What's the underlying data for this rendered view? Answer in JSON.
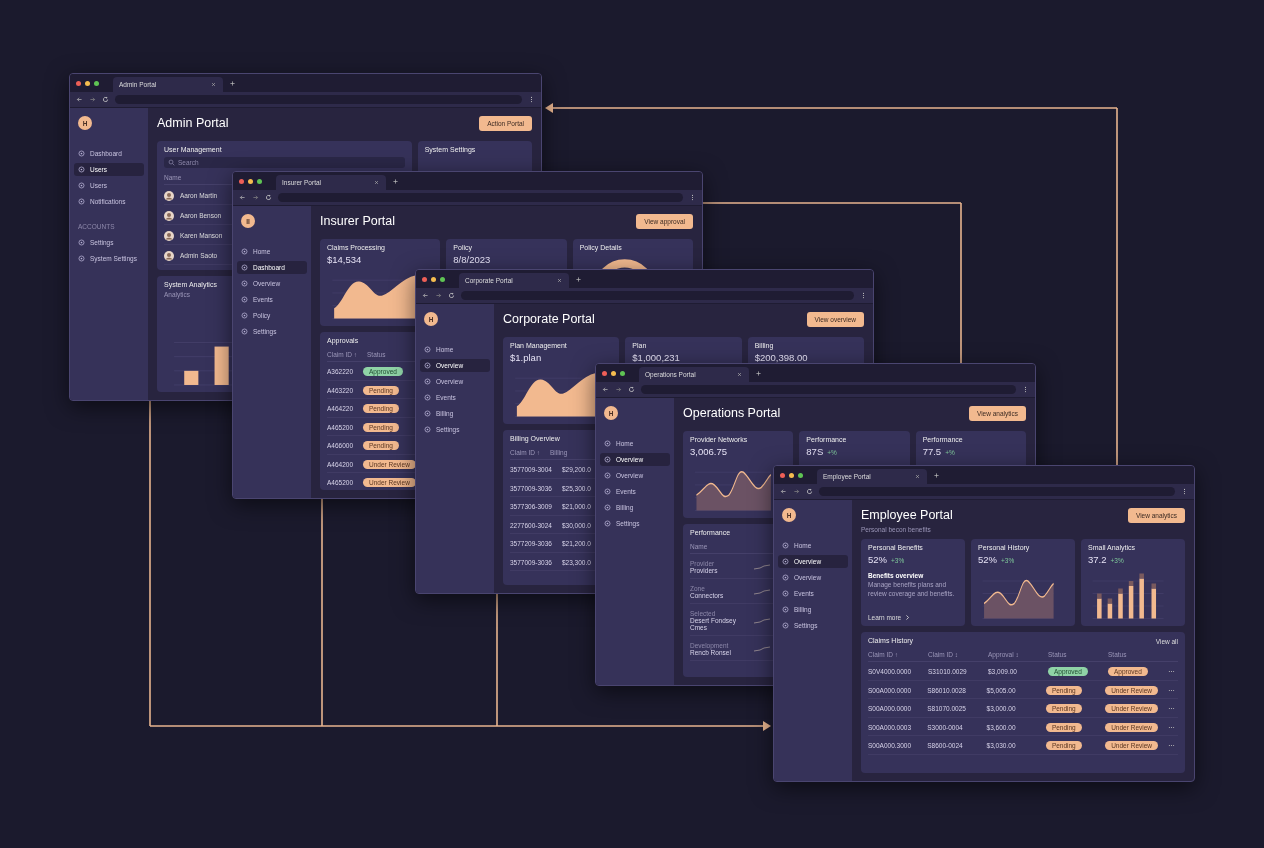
{
  "windows": [
    {
      "tab": "Admin Portal",
      "logo": "H",
      "heading": "Admin Portal",
      "action": "Action Portal",
      "nav": [
        {
          "label": "Dashboard",
          "selected": false
        },
        {
          "label": "Users",
          "selected": true
        },
        {
          "label": "Users",
          "selected": false
        },
        {
          "label": "Notifications",
          "selected": false
        }
      ],
      "nav_section": {
        "label": "ACCOUNTS",
        "items": [
          {
            "label": "Settings",
            "selected": false
          },
          {
            "label": "System Settings",
            "selected": false
          }
        ]
      },
      "rows": [
        [
          {
            "kind": "users",
            "title": "User Management",
            "placeholder": "Search",
            "columns": [
              "Name"
            ],
            "rows": [
              {
                "name": "Aaron Martin"
              },
              {
                "name": "Aaron Benson"
              },
              {
                "name": "Karen Manson"
              },
              {
                "name": "Admin Saoto"
              }
            ]
          },
          {
            "kind": "settings",
            "title": "System Settings"
          }
        ],
        [
          {
            "kind": "analytics",
            "title": "System Analytics",
            "subtitle": "Analytics"
          }
        ]
      ]
    },
    {
      "tab": "Insurer Portal",
      "logo": "II",
      "heading": "Insurer Portal",
      "action": "View approval",
      "nav": [
        {
          "label": "Home",
          "selected": false
        },
        {
          "label": "Dashboard",
          "selected": true
        },
        {
          "label": "Overview",
          "selected": false
        },
        {
          "label": "Events",
          "selected": false
        },
        {
          "label": "Policy",
          "selected": false
        },
        {
          "label": "Settings",
          "selected": false
        }
      ],
      "rows": [
        [
          {
            "kind": "area_stat",
            "title": "Claims Processing",
            "value": "$14,534"
          },
          {
            "kind": "stat",
            "title": "Policy",
            "value": "8/8/2023"
          },
          {
            "kind": "donut_stat",
            "title": "Policy Details"
          }
        ],
        [
          {
            "kind": "table",
            "title": "Approvals",
            "columns": [
              "Claim ID ↑",
              "Status"
            ],
            "rows": [
              {
                "cells": [
                  "A362220"
                ],
                "statuses": [
                  {
                    "label": "Approved",
                    "kind": "approved"
                  }
                ]
              },
              {
                "cells": [
                  "A463220"
                ],
                "statuses": [
                  {
                    "label": "Pending",
                    "kind": "pending"
                  }
                ]
              },
              {
                "cells": [
                  "A464220"
                ],
                "statuses": [
                  {
                    "label": "Pending",
                    "kind": "pending"
                  }
                ]
              },
              {
                "cells": [
                  "A465200"
                ],
                "statuses": [
                  {
                    "label": "Pending",
                    "kind": "pending"
                  }
                ]
              },
              {
                "cells": [
                  "A466000"
                ],
                "statuses": [
                  {
                    "label": "Pending",
                    "kind": "pending"
                  }
                ]
              },
              {
                "cells": [
                  "A464200"
                ],
                "statuses": [
                  {
                    "label": "Under Review",
                    "kind": "pending"
                  }
                ]
              },
              {
                "cells": [
                  "A465200"
                ],
                "statuses": [
                  {
                    "label": "Under Review",
                    "kind": "pending"
                  }
                ]
              }
            ]
          }
        ]
      ]
    },
    {
      "tab": "Corporate Portal",
      "logo": "H",
      "heading": "Corporate Portal",
      "action": "View overview",
      "nav": [
        {
          "label": "Home",
          "selected": false
        },
        {
          "label": "Overview",
          "selected": true
        },
        {
          "label": "Overview",
          "selected": false
        },
        {
          "label": "Events",
          "selected": false
        },
        {
          "label": "Billing",
          "selected": false
        },
        {
          "label": "Settings",
          "selected": false
        }
      ],
      "rows": [
        [
          {
            "kind": "area_stat",
            "title": "Plan Management",
            "value": "$1.plan"
          },
          {
            "kind": "stat",
            "title": "Plan",
            "value": "$1,000,231"
          },
          {
            "kind": "stat",
            "title": "Billing",
            "value": "$200,398.00"
          }
        ],
        [
          {
            "kind": "table",
            "title": "Billing Overview",
            "columns": [
              "Claim ID ↑",
              "Billing"
            ],
            "rows": [
              {
                "cells": [
                  "3577009-3004",
                  "$29,200.0"
                ]
              },
              {
                "cells": [
                  "3577009-3036",
                  "$25,300.0"
                ]
              },
              {
                "cells": [
                  "3577306-3009",
                  "$21,000.0"
                ]
              },
              {
                "cells": [
                  "2277600-3024",
                  "$30,000.0"
                ]
              },
              {
                "cells": [
                  "3577209-3036",
                  "$21,200.0"
                ]
              },
              {
                "cells": [
                  "3577009-3036",
                  "$23,300.0"
                ]
              }
            ]
          }
        ]
      ]
    },
    {
      "tab": "Operations Portal",
      "logo": "H",
      "heading": "Operations Portal",
      "action": "View analytics",
      "nav": [
        {
          "label": "Home",
          "selected": false
        },
        {
          "label": "Overview",
          "selected": true
        },
        {
          "label": "Overview",
          "selected": false
        },
        {
          "label": "Events",
          "selected": false
        },
        {
          "label": "Billing",
          "selected": false
        },
        {
          "label": "Settings",
          "selected": false
        }
      ],
      "rows": [
        [
          {
            "kind": "line_stat",
            "title": "Provider Networks",
            "value": "3,006.75"
          },
          {
            "kind": "stat",
            "title": "Performance",
            "value": "87S",
            "delta": "+%"
          },
          {
            "kind": "stat",
            "title": "Performance",
            "value": "77.5",
            "delta": "+%"
          }
        ],
        [
          {
            "kind": "people",
            "title": "Performance",
            "columns": [
              "Name"
            ],
            "rows": [
              {
                "caption": "Provider",
                "name": "Providers"
              },
              {
                "caption": "Zone",
                "name": "Connectors"
              },
              {
                "caption": "Selected",
                "name": "Desert Fondsey Cmes"
              },
              {
                "caption": "Development",
                "name": "Rencb Ronsel"
              }
            ]
          }
        ]
      ]
    },
    {
      "tab": "Employee Portal",
      "logo": "H",
      "heading": "Employee Portal",
      "subtitle": "Personal becon benefits",
      "action": "View analytics",
      "nav": [
        {
          "label": "Home",
          "selected": false
        },
        {
          "label": "Overview",
          "selected": true
        },
        {
          "label": "Overview",
          "selected": false
        },
        {
          "label": "Events",
          "selected": false
        },
        {
          "label": "Billing",
          "selected": false
        },
        {
          "label": "Settings",
          "selected": false
        }
      ],
      "rows": [
        [
          {
            "kind": "stat",
            "title": "Personal Benefits",
            "value": "52%",
            "delta": "+3%",
            "blurb_title": "Benefits overview",
            "blurb": "Manage benefits plans and review coverage and benefits.",
            "link": "Learn more"
          },
          {
            "kind": "line_stat",
            "title": "Personal History",
            "value": "52%",
            "delta": "+3%"
          },
          {
            "kind": "bar_stat",
            "title": "Small Analytics",
            "value": "37.2",
            "delta": "+3%"
          }
        ],
        [
          {
            "kind": "claims",
            "title": "Claims History",
            "link": "View all",
            "columns": [
              "Claim ID ↑",
              "Claim ID ↕",
              "Approval ↕",
              "Status",
              "Status"
            ],
            "rows": [
              {
                "cells": [
                  "S0V4000.0000",
                  "S31010.0029",
                  "$3,009.00"
                ],
                "statuses": [
                  {
                    "label": "Approved",
                    "kind": "approved"
                  },
                  {
                    "label": "Approved",
                    "kind": "pending"
                  }
                ]
              },
              {
                "cells": [
                  "S00A000.0000",
                  "S86010.0028",
                  "$5,005.00"
                ],
                "statuses": [
                  {
                    "label": "Pending",
                    "kind": "pending"
                  },
                  {
                    "label": "Under Review",
                    "kind": "pending"
                  }
                ]
              },
              {
                "cells": [
                  "S00A000.0000",
                  "S81070.0025",
                  "$3,000.00"
                ],
                "statuses": [
                  {
                    "label": "Pending",
                    "kind": "pending"
                  },
                  {
                    "label": "Under Review",
                    "kind": "pending"
                  }
                ]
              },
              {
                "cells": [
                  "S00A000.0003",
                  "S3000-0004",
                  "$3,600.00"
                ],
                "statuses": [
                  {
                    "label": "Pending",
                    "kind": "pending"
                  },
                  {
                    "label": "Under Review",
                    "kind": "pending"
                  }
                ]
              },
              {
                "cells": [
                  "S00A000.3000",
                  "S8600-0024",
                  "$3,030.00"
                ],
                "statuses": [
                  {
                    "label": "Pending",
                    "kind": "pending"
                  },
                  {
                    "label": "Under Review",
                    "kind": "pending"
                  }
                ]
              }
            ]
          }
        ]
      ]
    }
  ]
}
